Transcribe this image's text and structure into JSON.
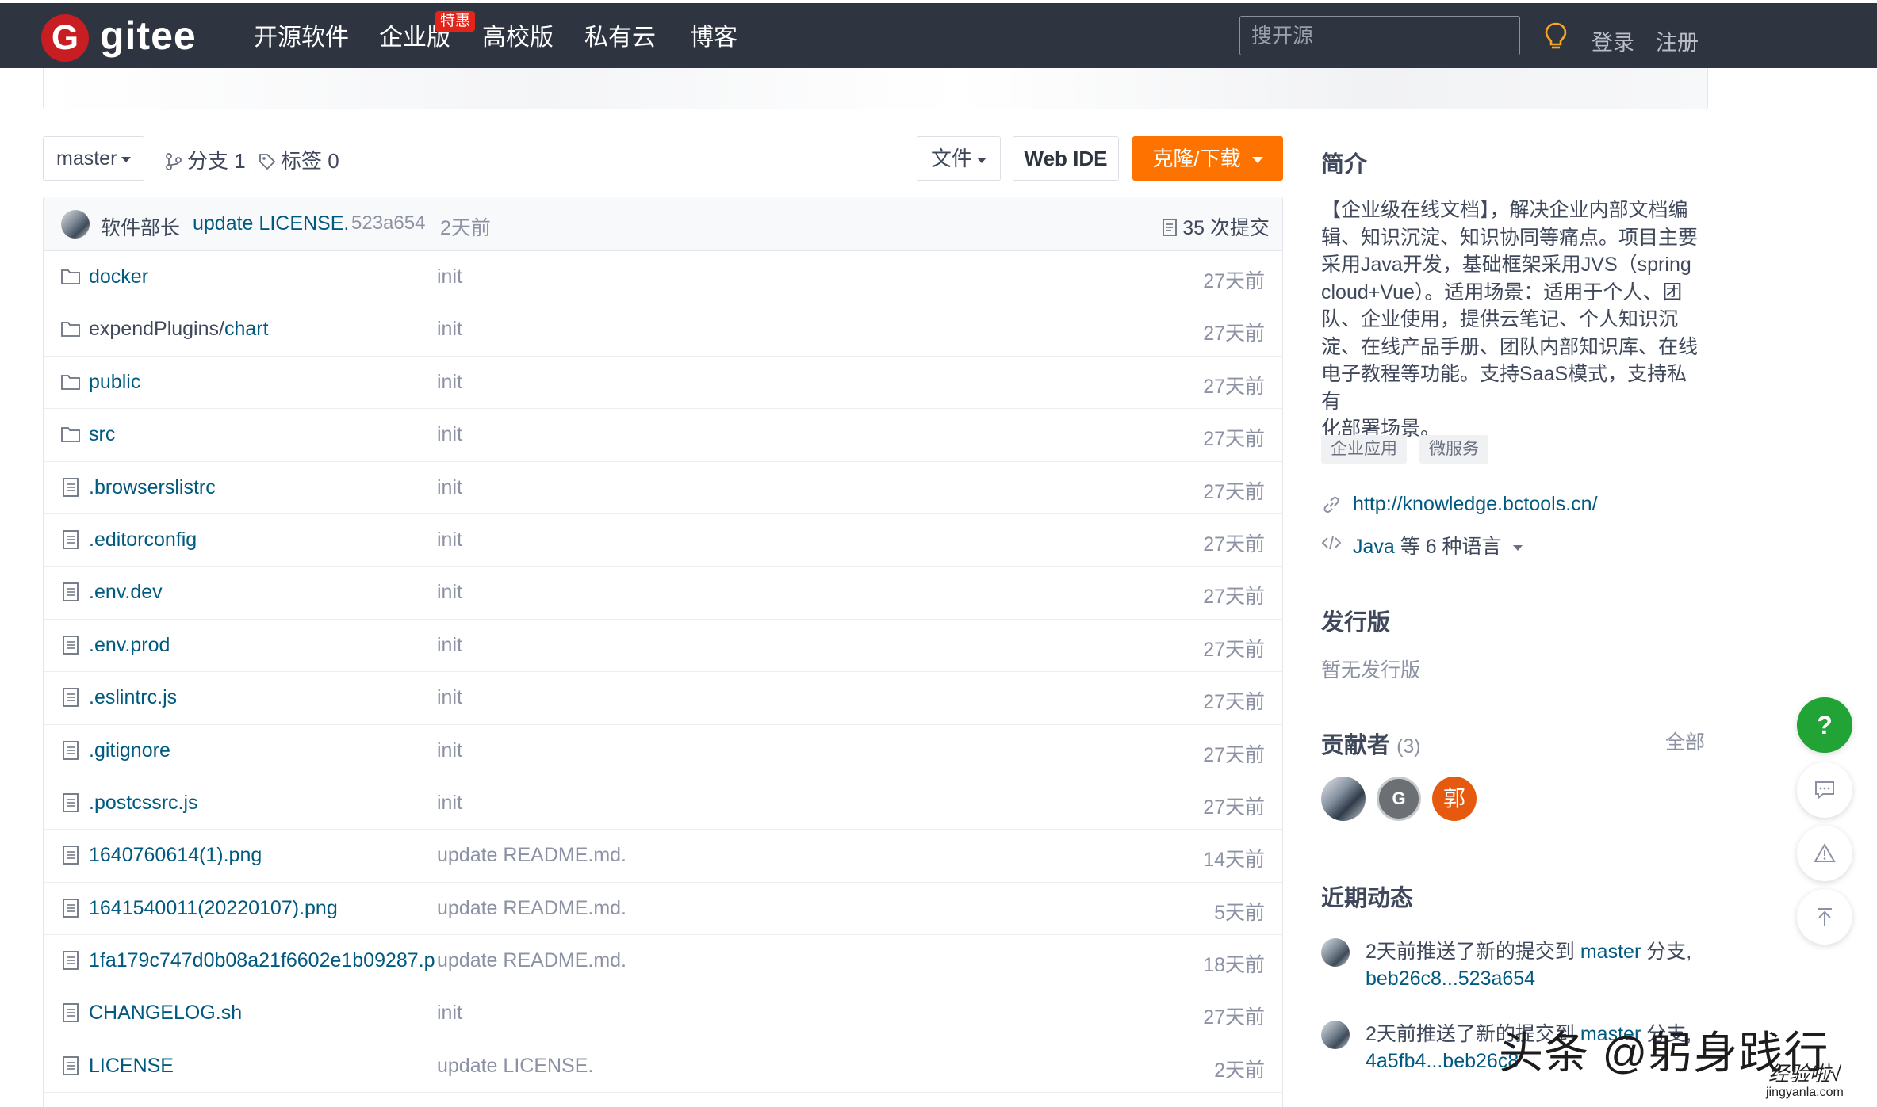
{
  "nav": {
    "logo_letter": "G",
    "brand": "gitee",
    "items": [
      "开源软件",
      "企业版",
      "高校版",
      "私有云",
      "博客"
    ],
    "badge": "特惠",
    "search_placeholder": "搜开源",
    "login": "登录",
    "register": "注册"
  },
  "toolbar": {
    "branch": "master",
    "branches": "分支 1",
    "tags": "标签 0",
    "file_btn": "文件",
    "webide_btn": "Web IDE",
    "clone_btn": "克隆/下载"
  },
  "commit": {
    "author": "软件部长",
    "message": "update LICENSE.",
    "sha": "523a654",
    "time": "2天前",
    "count": "35 次提交"
  },
  "files": [
    {
      "type": "folder",
      "name": "docker",
      "prefix": "",
      "msg": "init",
      "time": "27天前"
    },
    {
      "type": "folder",
      "name": "chart",
      "prefix": "expendPlugins/",
      "msg": "init",
      "time": "27天前"
    },
    {
      "type": "folder",
      "name": "public",
      "prefix": "",
      "msg": "init",
      "time": "27天前"
    },
    {
      "type": "folder",
      "name": "src",
      "prefix": "",
      "msg": "init",
      "time": "27天前"
    },
    {
      "type": "file",
      "name": ".browserslistrc",
      "prefix": "",
      "msg": "init",
      "time": "27天前"
    },
    {
      "type": "file",
      "name": ".editorconfig",
      "prefix": "",
      "msg": "init",
      "time": "27天前"
    },
    {
      "type": "file",
      "name": ".env.dev",
      "prefix": "",
      "msg": "init",
      "time": "27天前"
    },
    {
      "type": "file",
      "name": ".env.prod",
      "prefix": "",
      "msg": "init",
      "time": "27天前"
    },
    {
      "type": "file",
      "name": ".eslintrc.js",
      "prefix": "",
      "msg": "init",
      "time": "27天前"
    },
    {
      "type": "file",
      "name": ".gitignore",
      "prefix": "",
      "msg": "init",
      "time": "27天前"
    },
    {
      "type": "file",
      "name": ".postcssrc.js",
      "prefix": "",
      "msg": "init",
      "time": "27天前"
    },
    {
      "type": "file",
      "name": "1640760614(1).png",
      "prefix": "",
      "msg": "update README.md.",
      "time": "14天前"
    },
    {
      "type": "file",
      "name": "1641540011(20220107).png",
      "prefix": "",
      "msg": "update README.md.",
      "time": "5天前"
    },
    {
      "type": "file",
      "name": "1fa179c747d0b08a21f6602e1b09287.p...",
      "prefix": "",
      "msg": "update README.md.",
      "time": "18天前"
    },
    {
      "type": "file",
      "name": "CHANGELOG.sh",
      "prefix": "",
      "msg": "init",
      "time": "27天前"
    },
    {
      "type": "file",
      "name": "LICENSE",
      "prefix": "",
      "msg": "update LICENSE.",
      "time": "2天前"
    }
  ],
  "sidebar": {
    "intro_title": "简介",
    "intro_lines": [
      "【企业级在线文档】，解决企业内部文档编",
      "辑、知识沉淀、知识协同等痛点。项目主要",
      "采用Java开发，基础框架采用JVS（spring",
      "cloud+Vue）。适用场景：适用于个人、团",
      "队、企业使用，提供云笔记、个人知识沉",
      "淀、在线产品手册、团队内部知识库、在线",
      "电子教程等功能。支持SaaS模式，支持私有",
      "化部署场景。"
    ],
    "tags": [
      "企业应用",
      "微服务"
    ],
    "website": "http://knowledge.bctools.cn/",
    "lang_main": "Java",
    "lang_rest": " 等 6 种语言",
    "release_title": "发行版",
    "release_empty": "暂无发行版",
    "contrib_title": "贡献者",
    "contrib_count": "(3)",
    "contrib_all": "全部",
    "contrib_letter": "郭",
    "contrib_g": "G",
    "activity_title": "近期动态",
    "activity1_text": "2天前推送了新的提交到 ",
    "activity1_branch": "master",
    "activity1_suffix": " 分支,",
    "activity1_range": "beb26c8...523a654",
    "activity2_text": "2天前推送了新的提交到 ",
    "activity2_branch": "master",
    "activity2_suffix": " 分支,",
    "activity2_range": "4a5fb4...beb26c8"
  },
  "fab": {
    "help": "?"
  },
  "watermark": {
    "main": "头条 @躬身践行",
    "site": "经验啦√",
    "domain": "jingyanla.com"
  },
  "colors": {
    "nav_bg": "#2e3440",
    "brand_red": "#c71d23",
    "clone_orange": "#fe7300",
    "link_blue": "#005980",
    "help_green": "#21a336"
  }
}
